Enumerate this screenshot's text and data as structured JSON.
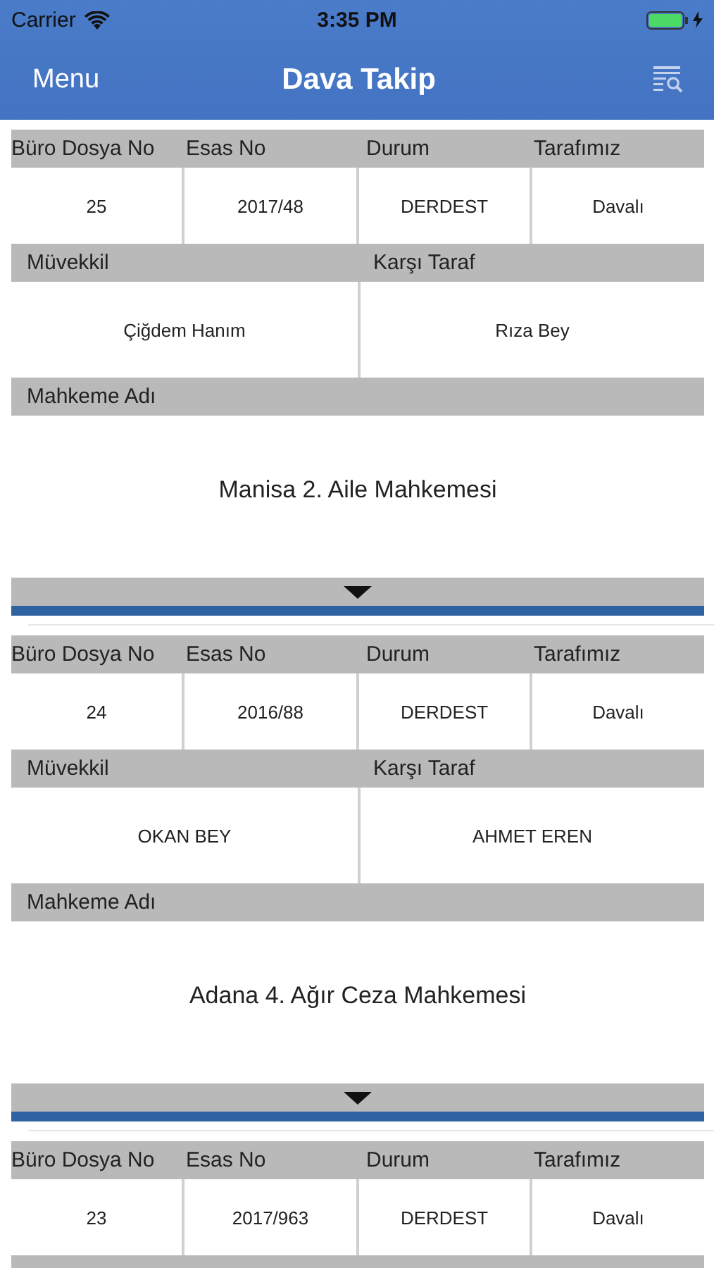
{
  "status_bar": {
    "carrier": "Carrier",
    "time": "3:35 PM"
  },
  "nav": {
    "left": "Menu",
    "title": "Dava Takip"
  },
  "cases": [
    {
      "columns": [
        "Büro Dosya No",
        "Esas No",
        "Durum",
        "Tarafımız"
      ],
      "values": [
        "25",
        "2017/48",
        "DERDEST",
        "Davalı"
      ],
      "party_labels": [
        "Müvekkil",
        "Karşı Taraf"
      ],
      "parties": [
        "Çiğdem Hanım",
        "Rıza Bey"
      ],
      "court_label": "Mahkeme Adı",
      "court": "Manisa 2. Aile Mahkemesi"
    },
    {
      "columns": [
        "Büro Dosya No",
        "Esas No",
        "Durum",
        "Tarafımız"
      ],
      "values": [
        "24",
        "2016/88",
        "DERDEST",
        "Davalı"
      ],
      "party_labels": [
        "Müvekkil",
        "Karşı Taraf"
      ],
      "parties": [
        "OKAN BEY",
        "AHMET EREN"
      ],
      "court_label": "Mahkeme Adı",
      "court": "Adana 4. Ağır Ceza Mahkemesi"
    },
    {
      "columns": [
        "Büro Dosya No",
        "Esas No",
        "Durum",
        "Tarafımız"
      ],
      "values": [
        "23",
        "2017/963",
        "DERDEST",
        "Davalı"
      ]
    }
  ]
}
